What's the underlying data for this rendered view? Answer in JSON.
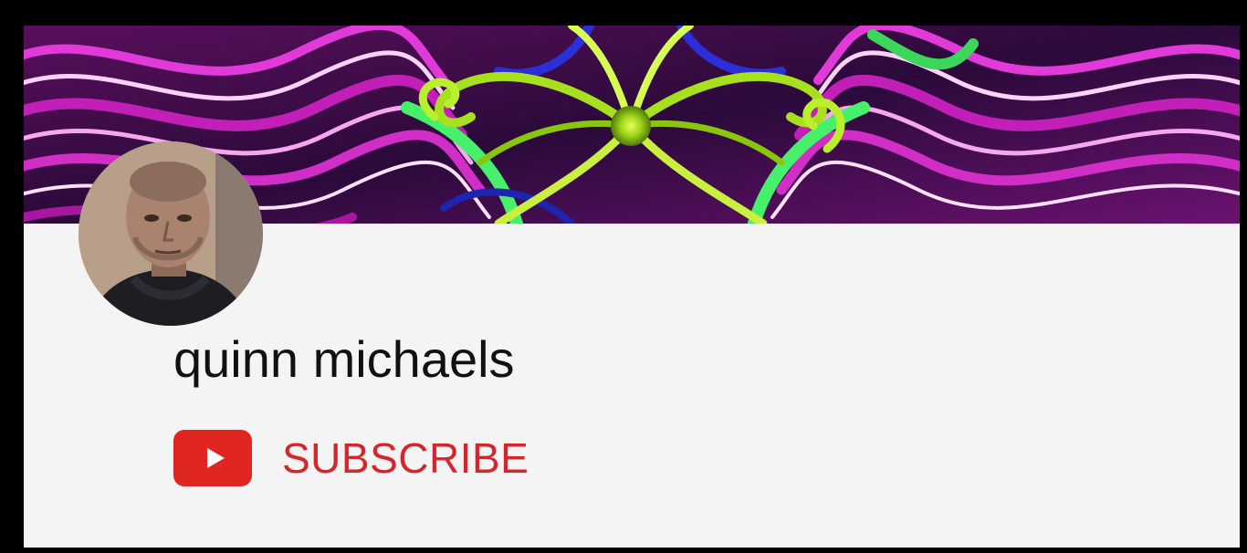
{
  "channel": {
    "name": "quinn michaels",
    "subscribe_label": "SUBSCRIBE"
  },
  "icons": {
    "subscribe": "youtube-play-icon",
    "avatar": "channel-avatar"
  },
  "colors": {
    "background": "#000000",
    "card": "#f4f4f4",
    "accent_red": "#e02620",
    "subscribe_text": "#d7262b",
    "banner_magenta": "#c21fb8",
    "banner_green": "#a7e01e"
  }
}
